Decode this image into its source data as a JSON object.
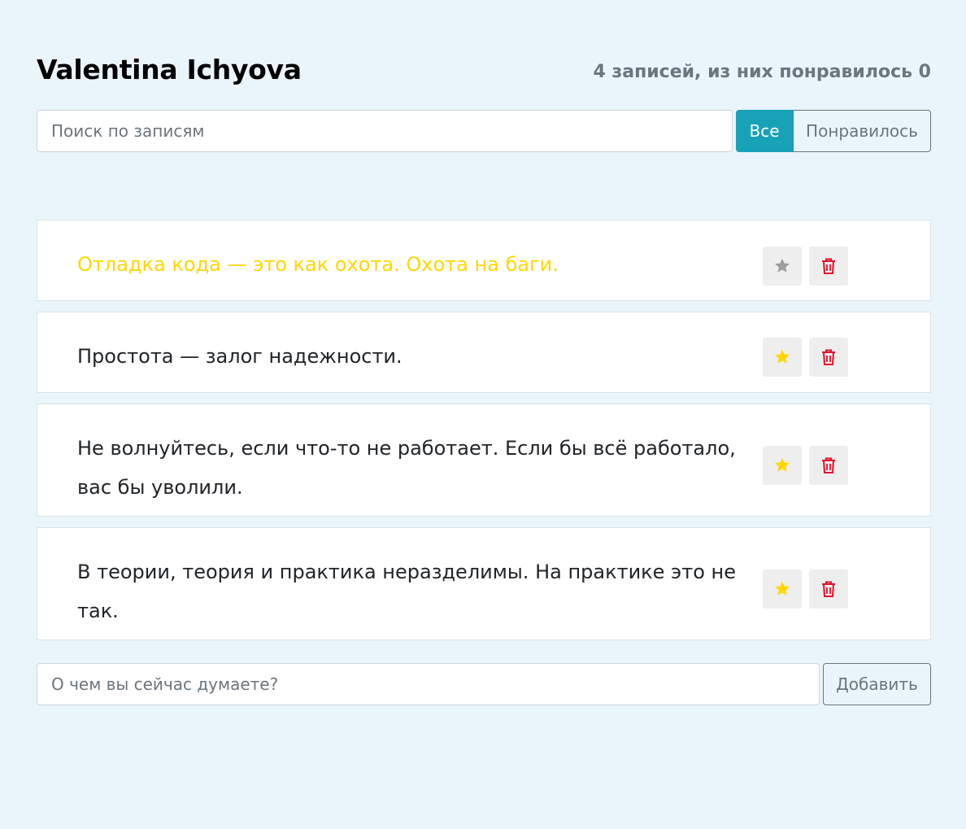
{
  "header": {
    "title": "Valentina Ichyova",
    "stats": "4 записей, из них понравилось 0"
  },
  "search": {
    "placeholder": "Поиск по записям"
  },
  "filters": {
    "all_label": "Все",
    "liked_label": "Понравилось",
    "active": "all"
  },
  "posts": [
    {
      "text": "Отладка кода — это как охота. Охота на баги.",
      "important": true,
      "liked": false
    },
    {
      "text": "Простота — залог надежности.",
      "important": false,
      "liked": true
    },
    {
      "text": "Не волнуйтесь, если что-то не работает. Если бы всё работало, вас бы уволили.",
      "important": false,
      "liked": true
    },
    {
      "text": "В теории, теория и практика неразделимы. На практике это не так.",
      "important": false,
      "liked": true
    }
  ],
  "add_form": {
    "placeholder": "О чем вы сейчас думаете?",
    "button_label": "Добавить"
  },
  "colors": {
    "star_active": "#ffd700",
    "star_inactive": "#9e9e9e",
    "trash": "#e0132b",
    "accent": "#17a2b8",
    "background": "#eaf4fb"
  },
  "icons": {
    "like": "star-icon",
    "delete": "trash-icon"
  }
}
